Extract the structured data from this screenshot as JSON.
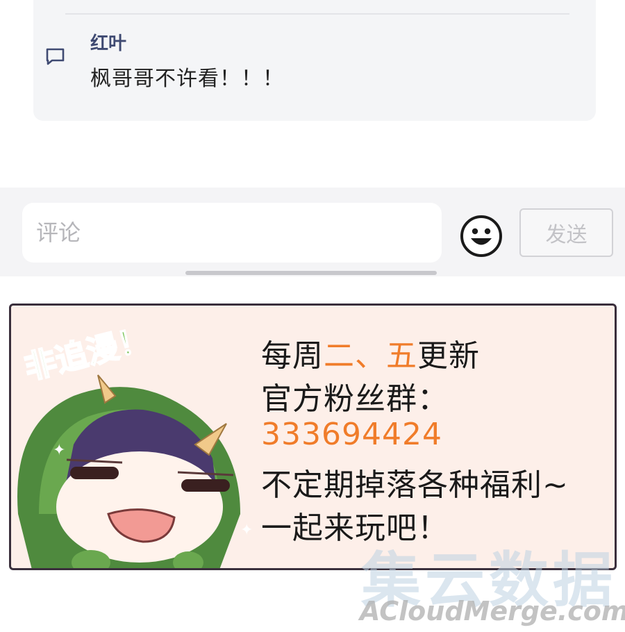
{
  "comment": {
    "author": "红叶",
    "text": "枫哥哥不许看！！！"
  },
  "input_bar": {
    "placeholder": "评论",
    "emoji_icon": "smiley-face-icon",
    "send_label": "发送"
  },
  "promo": {
    "badge_text": "非追漫！",
    "schedule": {
      "prefix": "每周",
      "day1": "二",
      "separator": "、",
      "day2": "五",
      "suffix": "更新"
    },
    "group_label": "官方粉丝群：",
    "group_number": "333694424",
    "benefit_text": "不定期掉落各种福利~",
    "invite_text": "一起来玩吧！",
    "accent_color": "#f07c2a"
  },
  "watermark": {
    "cn": "集云数据",
    "en": "ACloudMerge.com"
  }
}
